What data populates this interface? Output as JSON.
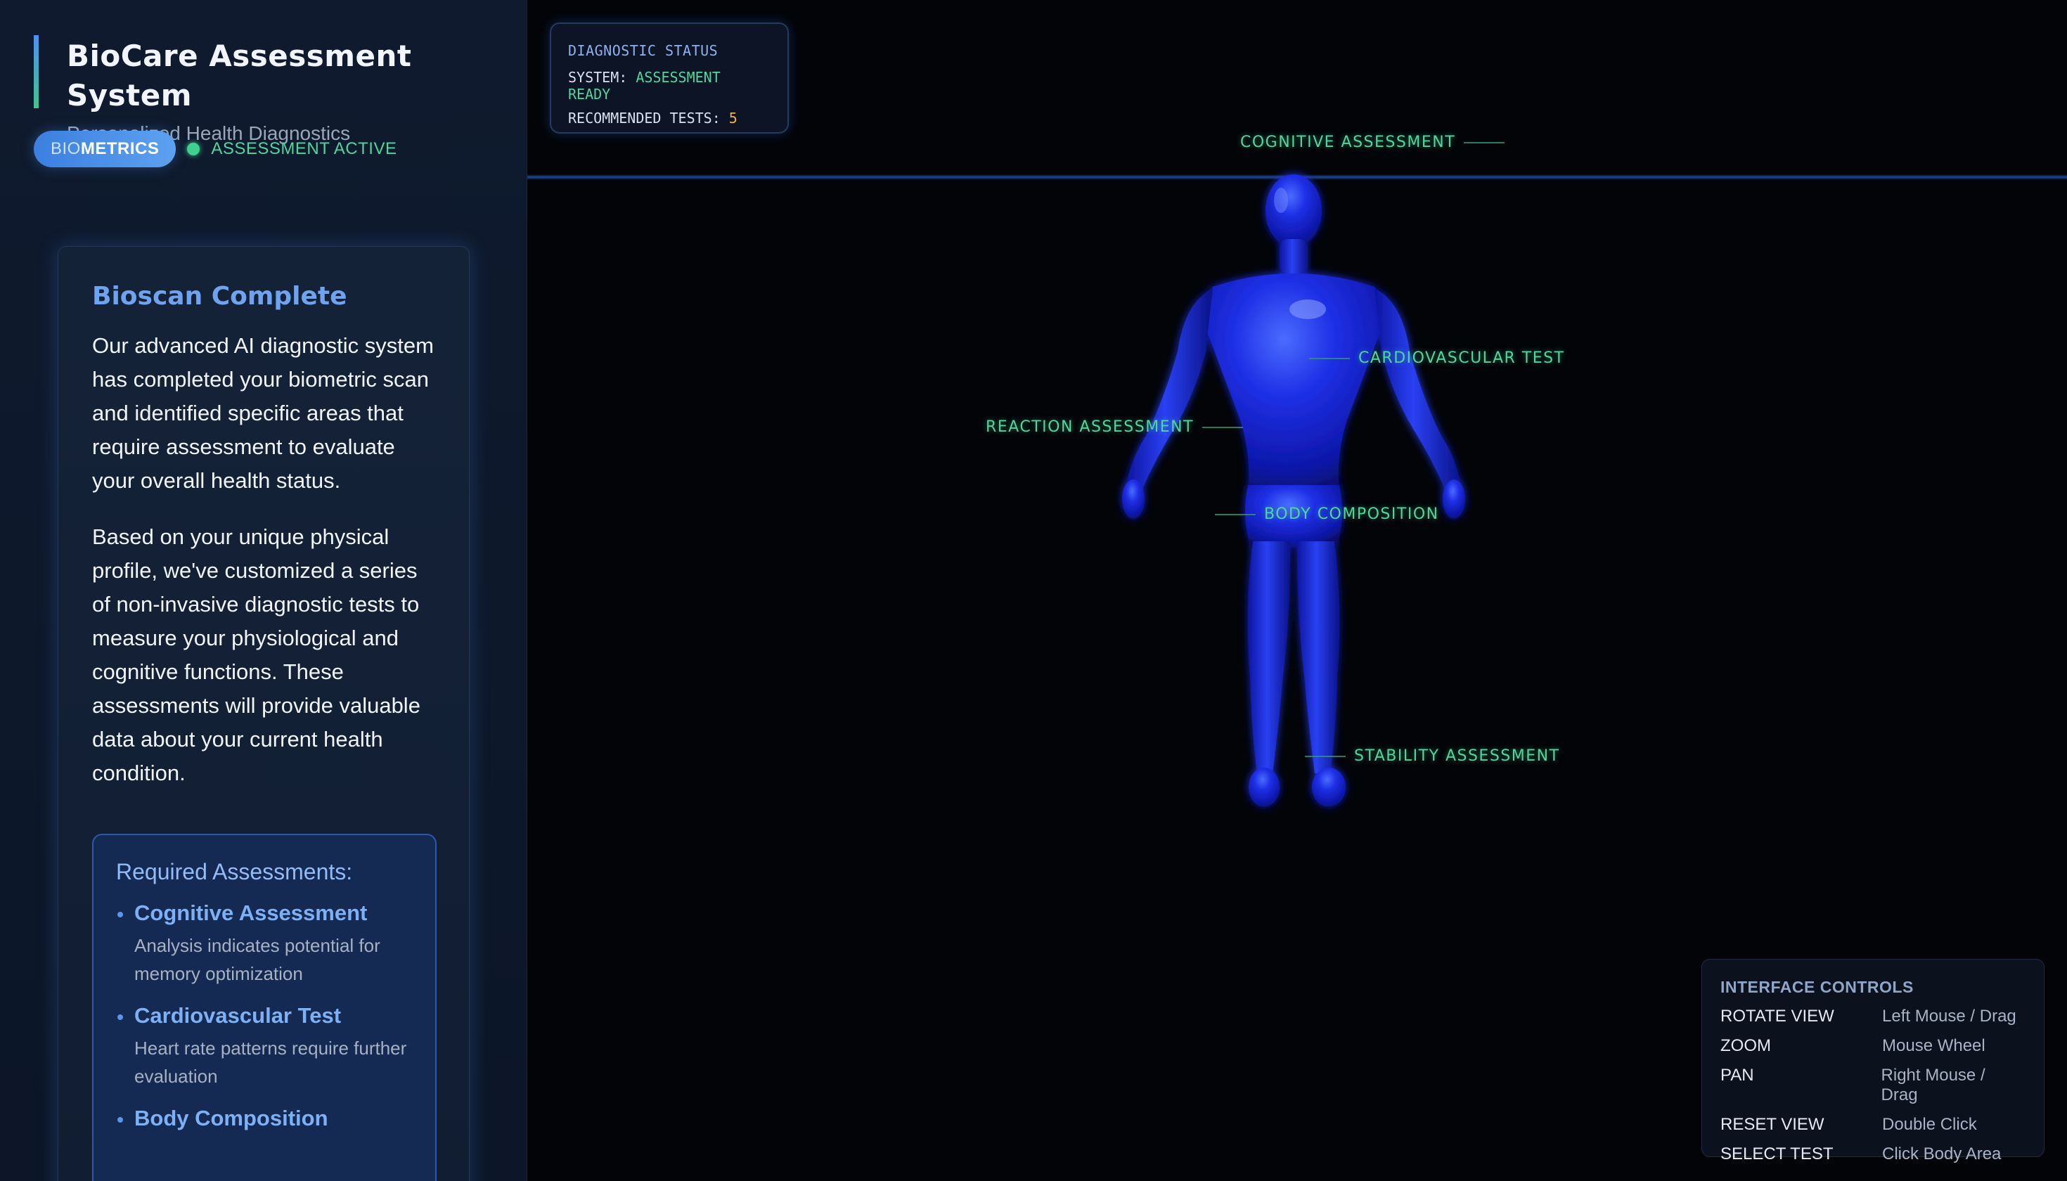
{
  "brand": {
    "title": "BioCare Assessment System",
    "subtitle": "Personalized Health Diagnostics"
  },
  "badge": {
    "prefix": "BIO",
    "label": "METRICS"
  },
  "status": {
    "label": "ASSESSMENT ACTIVE",
    "color": "#3fcf8e"
  },
  "card": {
    "title": "Bioscan Complete",
    "paragraphs": [
      "Our advanced AI diagnostic system has completed your biometric scan and identified specific areas that require assessment to evaluate your overall health status.",
      "Based on your unique physical profile, we've customized a series of non-invasive diagnostic tests to measure your physiological and cognitive functions. These assessments will provide valuable data about your current health condition."
    ],
    "required": {
      "title": "Required Assessments:",
      "items": [
        {
          "name": "Cognitive Assessment",
          "desc": "Analysis indicates potential for memory optimization"
        },
        {
          "name": "Cardiovascular Test",
          "desc": "Heart rate patterns require further evaluation"
        },
        {
          "name": "Body Composition",
          "desc": ""
        }
      ]
    }
  },
  "diagnostic": {
    "title": "DIAGNOSTIC STATUS",
    "system_label": "SYSTEM:",
    "system_value": "ASSESSMENT READY",
    "tests_label": "RECOMMENDED TESTS:",
    "tests_value": "5"
  },
  "hotspots": {
    "cognitive": "COGNITIVE ASSESSMENT",
    "cardiovascular": "CARDIOVASCULAR TEST",
    "reaction": "REACTION ASSESSMENT",
    "body": "BODY COMPOSITION",
    "stability": "STABILITY ASSESSMENT"
  },
  "controls": {
    "title": "INTERFACE CONTROLS",
    "rows": [
      {
        "key": "ROTATE VIEW",
        "value": "Left Mouse / Drag"
      },
      {
        "key": "ZOOM",
        "value": "Mouse Wheel"
      },
      {
        "key": "PAN",
        "value": "Right Mouse / Drag"
      },
      {
        "key": "RESET VIEW",
        "value": "Double Click"
      },
      {
        "key": "SELECT TEST",
        "value": "Click Body Area"
      }
    ]
  },
  "colors": {
    "accent": "#4f8ff0",
    "success": "#4fd69c",
    "warning": "#f0b040",
    "model": "#1a2fe0"
  }
}
